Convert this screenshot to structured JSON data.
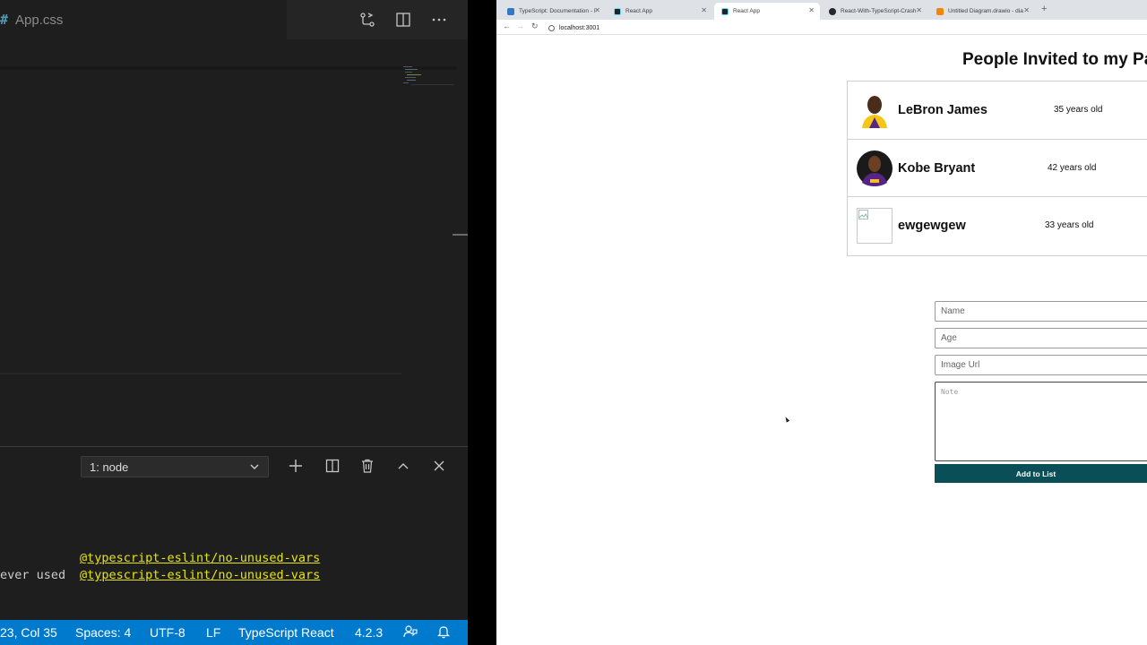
{
  "vscode": {
    "tab": {
      "icon": "css-hash-icon",
      "filename": "App.css"
    },
    "actions": [
      "source-control-icon",
      "split-editor-icon",
      "more-actions-icon"
    ],
    "terminal": {
      "selected": "1: node",
      "icons": [
        "add-icon",
        "split-terminal-icon",
        "trash-icon",
        "maximize-icon",
        "close-icon"
      ],
      "lines": [
        {
          "prefix": "",
          "rule": "@typescript-eslint/no-unused-vars"
        },
        {
          "prefix": "ever used",
          "rule": "@typescript-eslint/no-unused-vars"
        }
      ]
    },
    "status": {
      "position": "23, Col 35",
      "spaces": "Spaces: 4",
      "encoding": "UTF-8",
      "eol": "LF",
      "language": "TypeScript React",
      "version": "4.2.3"
    }
  },
  "browser": {
    "tabs": [
      {
        "title": "TypeScript: Documentation - I",
        "favicon": "typescript-favicon",
        "active": false
      },
      {
        "title": "React App",
        "favicon": "react-favicon",
        "active": false
      },
      {
        "title": "React App",
        "favicon": "react-favicon",
        "active": true
      },
      {
        "title": "React-With-TypeScript-Crash",
        "favicon": "github-favicon",
        "active": false
      },
      {
        "title": "Untitled Diagram.drawio - dia",
        "favicon": "drawio-favicon",
        "active": false
      }
    ],
    "url": "localhost:3001"
  },
  "page": {
    "title": "People Invited to my Pa",
    "guests": [
      {
        "name": "LeBron James",
        "age": "35 years old",
        "avatar": "lebron-photo"
      },
      {
        "name": "Kobe Bryant",
        "age": "42 years old",
        "avatar": "kobe-photo"
      },
      {
        "name": "ewgewgew",
        "age": "33 years old",
        "avatar": "broken-image"
      }
    ],
    "form": {
      "name_placeholder": "Name",
      "age_placeholder": "Age",
      "image_placeholder": "Image Url",
      "note_placeholder": "Note",
      "button_label": "Add to List"
    }
  },
  "colors": {
    "status_bar": "#007acc",
    "terminal_rule": "#e5e510",
    "add_button": "#0a4f58"
  }
}
